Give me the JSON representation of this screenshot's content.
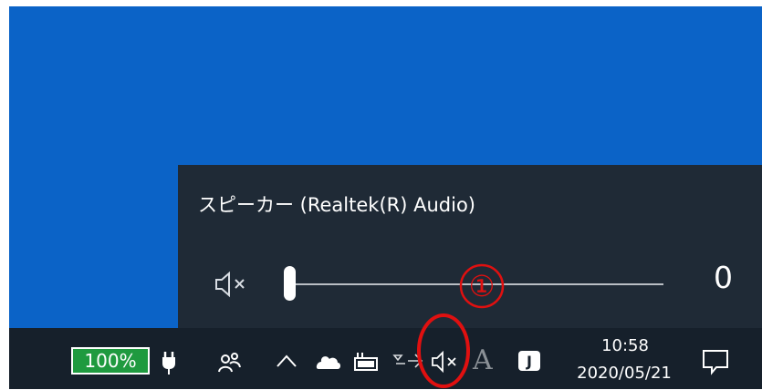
{
  "volume_flyout": {
    "device_name": "スピーカー (Realtek(R) Audio)",
    "mute_icon": "speaker-muted-icon",
    "volume_value": "0",
    "volume_level": 0,
    "annotation_number": "①"
  },
  "taskbar": {
    "battery_percent": "100%",
    "icons": [
      "power-plug-icon",
      "people-icon",
      "chevron-up-icon",
      "onedrive-cloud-icon",
      "battery-manager-icon",
      "network-icon",
      "speaker-muted-icon",
      "ime-mode-icon",
      "app-j-icon",
      "notification-icon"
    ],
    "ime_letter": "A",
    "app_letter": "J",
    "clock_time": "10:58",
    "clock_date": "2020/05/21"
  },
  "colors": {
    "desktop": "#0b63c7",
    "flyout": "#1f2a36",
    "taskbar": "#16202b",
    "battery": "#1f9a3f",
    "annotation": "#e01010"
  }
}
